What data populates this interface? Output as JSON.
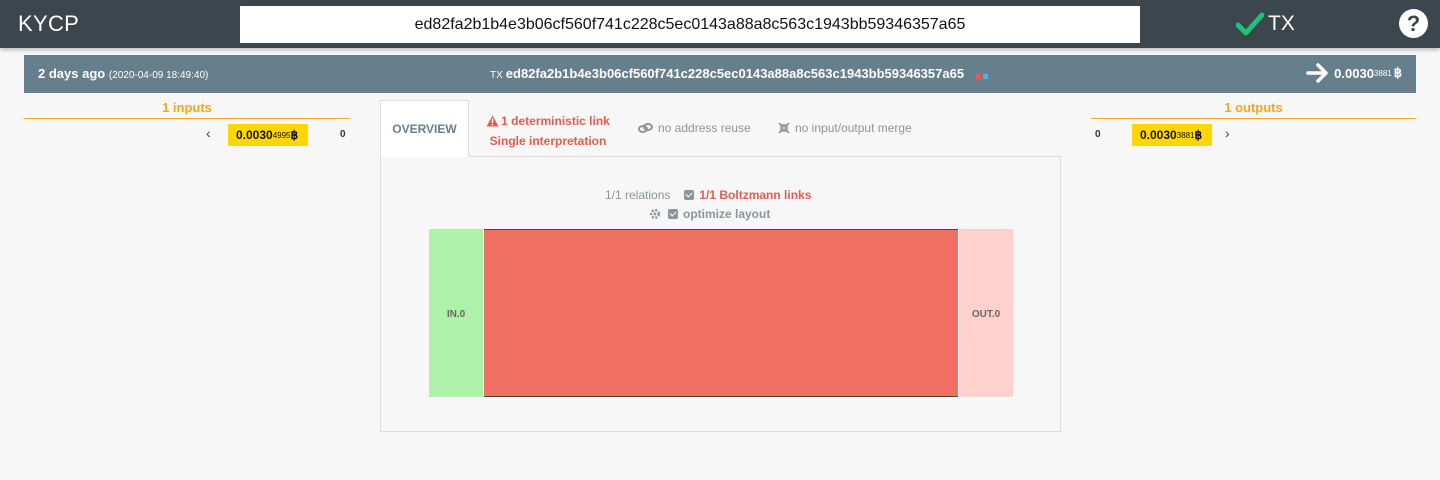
{
  "header": {
    "logo": "KYCP",
    "search_value": "ed82fa2b1b4e3b06cf560f741c228c5ec0143a88a8c563c1943bb59346357a65",
    "status_label": "TX",
    "help_glyph": "?"
  },
  "infobar": {
    "age": "2 days ago",
    "timestamp": "(2020-04-09 18:49:40)",
    "tx_prefix": "TX",
    "txid": "ed82fa2b1b4e3b06cf560f741c228c5ec0143a88a8c563c1943bb59346357a65",
    "amount_main": "0.0030",
    "amount_small": "3881",
    "currency": "฿"
  },
  "inputs": {
    "header": "1 inputs",
    "items": [
      {
        "value_main": "0.0030",
        "value_small": "4995",
        "currency": "฿",
        "index": "0"
      }
    ],
    "prev_glyph": "‹"
  },
  "outputs": {
    "header": "1 outputs",
    "items": [
      {
        "value_main": "0.0030",
        "value_small": "3881",
        "currency": "฿",
        "index": "0"
      }
    ],
    "next_glyph": "›"
  },
  "tabs": {
    "overview": "OVERVIEW",
    "deterministic_line1": "1 deterministic link",
    "deterministic_line2": "Single interpretation",
    "address_reuse": "no address reuse",
    "io_merge": "no input/output merge"
  },
  "panel": {
    "relations": "1/1 relations",
    "boltzmann": "1/1 Boltzmann links",
    "optimize": "optimize layout"
  },
  "graph": {
    "inputs": [
      {
        "label": "IN.0"
      }
    ],
    "outputs": [
      {
        "label": "OUT.0"
      }
    ],
    "links": [
      {
        "from": 0,
        "to": 0,
        "probability": 1
      }
    ]
  },
  "colors": {
    "topbar": "#3c474d",
    "infobar": "#667f8d",
    "accent_orange": "#f5a623",
    "value_yellow": "#ffd600",
    "deterministic_red": "#e55c4f",
    "input_node": "#aef1a8",
    "output_node": "#ffd1cc",
    "link_fill": "#f07163",
    "check_green": "#1ec37a"
  }
}
